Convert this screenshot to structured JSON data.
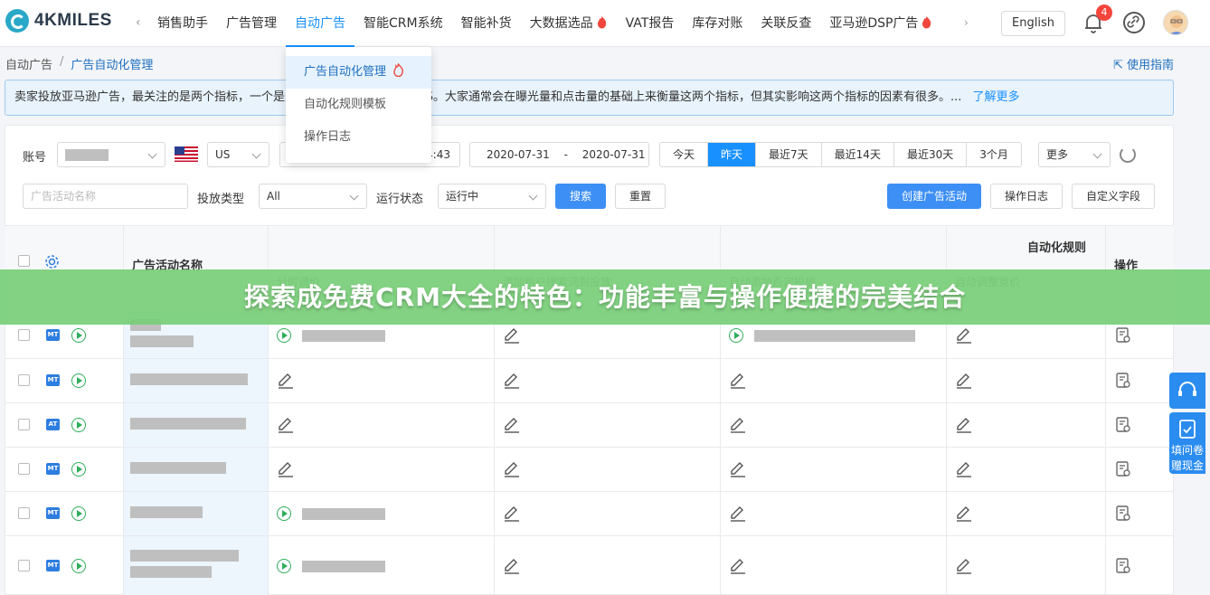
{
  "app": {
    "logo_text": "4KMILES"
  },
  "nav": {
    "items": [
      "销售助手",
      "广告管理",
      "自动广告",
      "智能CRM系统",
      "智能补货",
      "大数据选品",
      "VAT报告",
      "库存对账",
      "关联反查",
      "亚马逊DSP广告"
    ],
    "active_index": 2,
    "hot_items": [
      "大数据选品",
      "亚马逊DSP广告"
    ]
  },
  "header": {
    "language_label": "English",
    "notification_count": "4"
  },
  "breadcrumb": {
    "root": "自动广告",
    "separator": "/",
    "current": "广告自动化管理"
  },
  "guide_link": "使用指南",
  "notice": {
    "text": "卖家投放亚马逊广告，最关注的是两个指标，一个是点击率，一个是广告的ACoS。大家通常会在曝光量和点击量的基础上来衡量这两个指标，但其实影响这两个指标的因素有很多。...",
    "more_link": "了解更多"
  },
  "dropdown": {
    "items": [
      "广告自动化管理",
      "自动化规则模板",
      "操作日志"
    ],
    "selected_index": 0
  },
  "filters": {
    "account_label": "账号",
    "marketplace_value": "US",
    "time_fragment": "4:43",
    "date_start": "2020-07-31",
    "date_sep": "-",
    "date_end": "2020-07-31",
    "quick_ranges": [
      "今天",
      "昨天",
      "最近7天",
      "最近14天",
      "最近30天",
      "3个月"
    ],
    "quick_active_index": 1,
    "more_label": "更多",
    "campaign_name_placeholder": "广告活动名称",
    "placement_type_label": "投放类型",
    "placement_type_value": "All",
    "run_status_label": "运行状态",
    "run_status_value": "运行中",
    "search_button": "搜索",
    "reset_button": "重置",
    "create_button": "创建广告活动",
    "log_button": "操作日志",
    "custom_fields_button": "自定义字段"
  },
  "table": {
    "group_header": "自动化规则",
    "col_name": "广告活动名称",
    "col_action": "操作",
    "sub_headers": [
      "分时调价",
      "添加用户搜索词到投放",
      "自动添加否定投放",
      "自动调整竞价"
    ],
    "rows": [
      {
        "type": "MT"
      },
      {
        "type": "MT"
      },
      {
        "type": "AT"
      },
      {
        "type": "MT"
      },
      {
        "type": "MT"
      },
      {
        "type": "MT"
      }
    ]
  },
  "banner": {
    "text": "探索成免费CRM大全的特色：功能丰富与操作便捷的完美结合"
  },
  "side": {
    "survey_line1": "填问卷",
    "survey_line2": "赠现金"
  }
}
